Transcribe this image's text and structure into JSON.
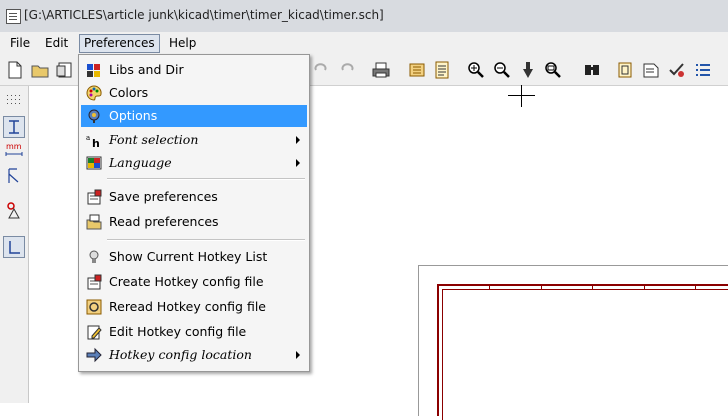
{
  "window": {
    "title": "[G:\\ARTICLES\\article junk\\kicad\\timer\\timer_kicad\\timer.sch]"
  },
  "menubar": {
    "file": "File",
    "edit": "Edit",
    "preferences": "Preferences",
    "help": "Help"
  },
  "preferences_menu": {
    "libs_and_dir": "Libs and Dir",
    "colors": "Colors",
    "options": "Options",
    "font_selection": "Font selection",
    "language": "Language",
    "save_preferences": "Save preferences",
    "read_preferences": "Read preferences",
    "show_hotkey_list": "Show Current Hotkey List",
    "create_hotkey_config": "Create Hotkey config file",
    "reread_hotkey_config": "Reread Hotkey config file",
    "edit_hotkey_config": "Edit Hotkey config file",
    "hotkey_config_location": "Hotkey config location"
  },
  "left_toolbar": {
    "units_label": "mm"
  },
  "colors": {
    "highlight": "#3399ff",
    "sheet_border": "#8b0000",
    "menu_bg": "#f5f5f5"
  }
}
